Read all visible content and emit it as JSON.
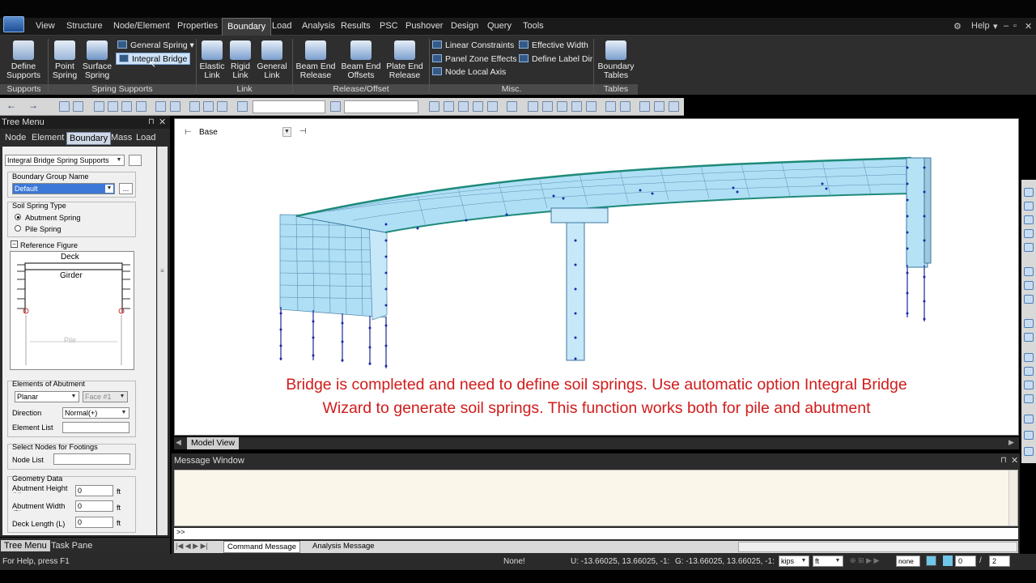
{
  "menu": [
    "View",
    "Structure",
    "Node/Element",
    "Properties",
    "Boundary",
    "Load",
    "Analysis",
    "Results",
    "PSC",
    "Pushover",
    "Design",
    "Query",
    "Tools"
  ],
  "menu_active": "Boundary",
  "help_label": "Help",
  "ribbon": {
    "define_supports": "Define Supports",
    "general_spring": "General Spring",
    "integral_bridge": "Integral Bridge",
    "point_spring": "Point Spring",
    "surface_spring": "Surface Spring",
    "elastic_link": "Elastic Link",
    "rigid_link": "Rigid Link",
    "general_link": "General Link",
    "beam_end_release": "Beam End Release",
    "beam_end_offsets": "Beam End Offsets",
    "plate_end_release": "Plate End Release",
    "linear_constraints": "Linear Constraints",
    "panel_zone_effects": "Panel Zone Effects",
    "node_local_axis": "Node Local Axis",
    "effective_width": "Effective Width",
    "define_label_dir": "Define Label Dir",
    "boundary_tables": "Boundary Tables",
    "groups": [
      "Supports",
      "Spring Supports",
      "Link",
      "Release/Offset",
      "Misc.",
      "Tables"
    ]
  },
  "tree": {
    "title": "Tree Menu",
    "tabs": [
      "Node",
      "Element",
      "Boundary",
      "Mass",
      "Load"
    ],
    "active_tab": "Boundary",
    "function_select": "Integral Bridge Spring Supports",
    "boundary_group_label": "Boundary Group Name",
    "boundary_group_value": "Default",
    "soil_spring_type_label": "Soil Spring Type",
    "abutment_spring": "Abutment Spring",
    "pile_spring": "Pile Spring",
    "reference_figure": "Reference Figure",
    "fig_deck": "Deck",
    "fig_girder": "Girder",
    "fig_pile": "Pile",
    "elements_of_abutment": "Elements of Abutment",
    "planar": "Planar",
    "face": "Face #1",
    "direction_label": "Direction",
    "direction_value": "Normal(+)",
    "element_list_label": "Element List",
    "select_nodes_label": "Select Nodes for Footings",
    "node_list_label": "Node List",
    "geometry_label": "Geometry Data",
    "abutment_height_label": "Abutment Height (H)",
    "abutment_height": "0",
    "abutment_width_label": "Abutment Width (B)",
    "abutment_width": "0",
    "deck_length_label": "Deck Length (L)",
    "deck_length": "0",
    "unit": "ft"
  },
  "bottom_tabs": [
    "Tree Menu",
    "Task Pane"
  ],
  "model_view": {
    "base_label": "Base",
    "tab_label": "Model View",
    "caption_line1": "Bridge is completed and need to define soil springs. Use automatic option Integral Bridge",
    "caption_line2": "Wizard to generate soil springs. This function works both for pile and abutment"
  },
  "message_window": {
    "title": "Message Window",
    "prompt": ">>",
    "tabs": [
      "Command Message",
      "Analysis Message"
    ]
  },
  "status": {
    "help": "For Help, press F1",
    "selection": "None!",
    "coord_u": "U: -13.66025, 13.66025, -1:",
    "coord_g": "G: -13.66025, 13.66025, -1:",
    "force_unit": "kips",
    "length_unit": "ft",
    "page_a": "0",
    "page_b": "2",
    "none_select": "none"
  },
  "colors": {
    "accent": "#3b78d8",
    "caption": "#d21b1b",
    "bridge": "#aedff5",
    "node": "#1a2aa8"
  }
}
